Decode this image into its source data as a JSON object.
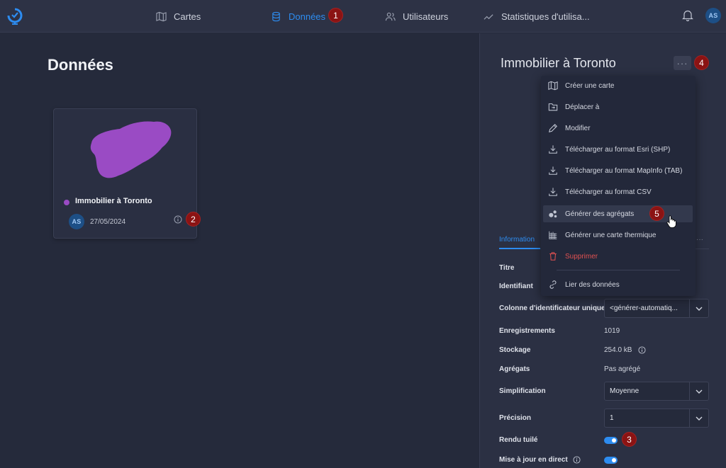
{
  "topbar": {
    "nav": [
      {
        "label": "Cartes",
        "icon": "map-icon",
        "active": false
      },
      {
        "label": "Données",
        "icon": "database-icon",
        "active": true
      },
      {
        "label": "Utilisateurs",
        "icon": "users-icon",
        "active": false
      },
      {
        "label": "Statistiques d'utilisa...",
        "icon": "chart-line-icon",
        "active": false
      }
    ],
    "user_initials": "AS"
  },
  "page": {
    "title": "Données"
  },
  "card": {
    "title": "Immobilier à Toronto",
    "date": "27/05/2024",
    "owner_initials": "AS",
    "color": "#9a4bc4"
  },
  "panel": {
    "title": "Immobilier à Toronto",
    "more_label": "···",
    "tab_label": "Information",
    "tab_more": "···",
    "fields": {
      "titre": "Titre",
      "identifiant": "Identifiant",
      "colonne_label": "Colonne d'identificateur unique",
      "colonne_value": "<générer-automatiq...",
      "enregistrements_label": "Enregistrements",
      "enregistrements_value": "1019",
      "stockage_label": "Stockage",
      "stockage_value": "254.0 kB",
      "agregats_label": "Agrégats",
      "agregats_value": "Pas agrégé",
      "simplification_label": "Simplification",
      "simplification_value": "Moyenne",
      "precision_label": "Précision",
      "precision_value": "1",
      "rendu_label": "Rendu tuilé",
      "mise_label": "Mise à jour en direct"
    }
  },
  "menu": {
    "items": [
      {
        "label": "Créer une carte",
        "icon": "map-icon"
      },
      {
        "label": "Déplacer à",
        "icon": "folder-move-icon"
      },
      {
        "label": "Modifier",
        "icon": "pencil-icon"
      },
      {
        "label": "Télécharger au format Esri (SHP)",
        "icon": "download-icon"
      },
      {
        "label": "Télécharger au format MapInfo (TAB)",
        "icon": "download-icon"
      },
      {
        "label": "Télécharger au format CSV",
        "icon": "download-icon"
      },
      {
        "label": "Générer des agrégats",
        "icon": "bubbles-icon"
      },
      {
        "label": "Générer une carte thermique",
        "icon": "grid-icon"
      },
      {
        "label": "Supprimer",
        "icon": "trash-icon"
      },
      {
        "label": "Lier des données",
        "icon": "link-icon"
      }
    ]
  },
  "annotations": {
    "b1": "1",
    "b2": "2",
    "b3": "3",
    "b4": "4",
    "b5": "5"
  },
  "colors": {
    "accent": "#2d8cf0",
    "danger": "#e05151",
    "badge": "#8b1313"
  }
}
